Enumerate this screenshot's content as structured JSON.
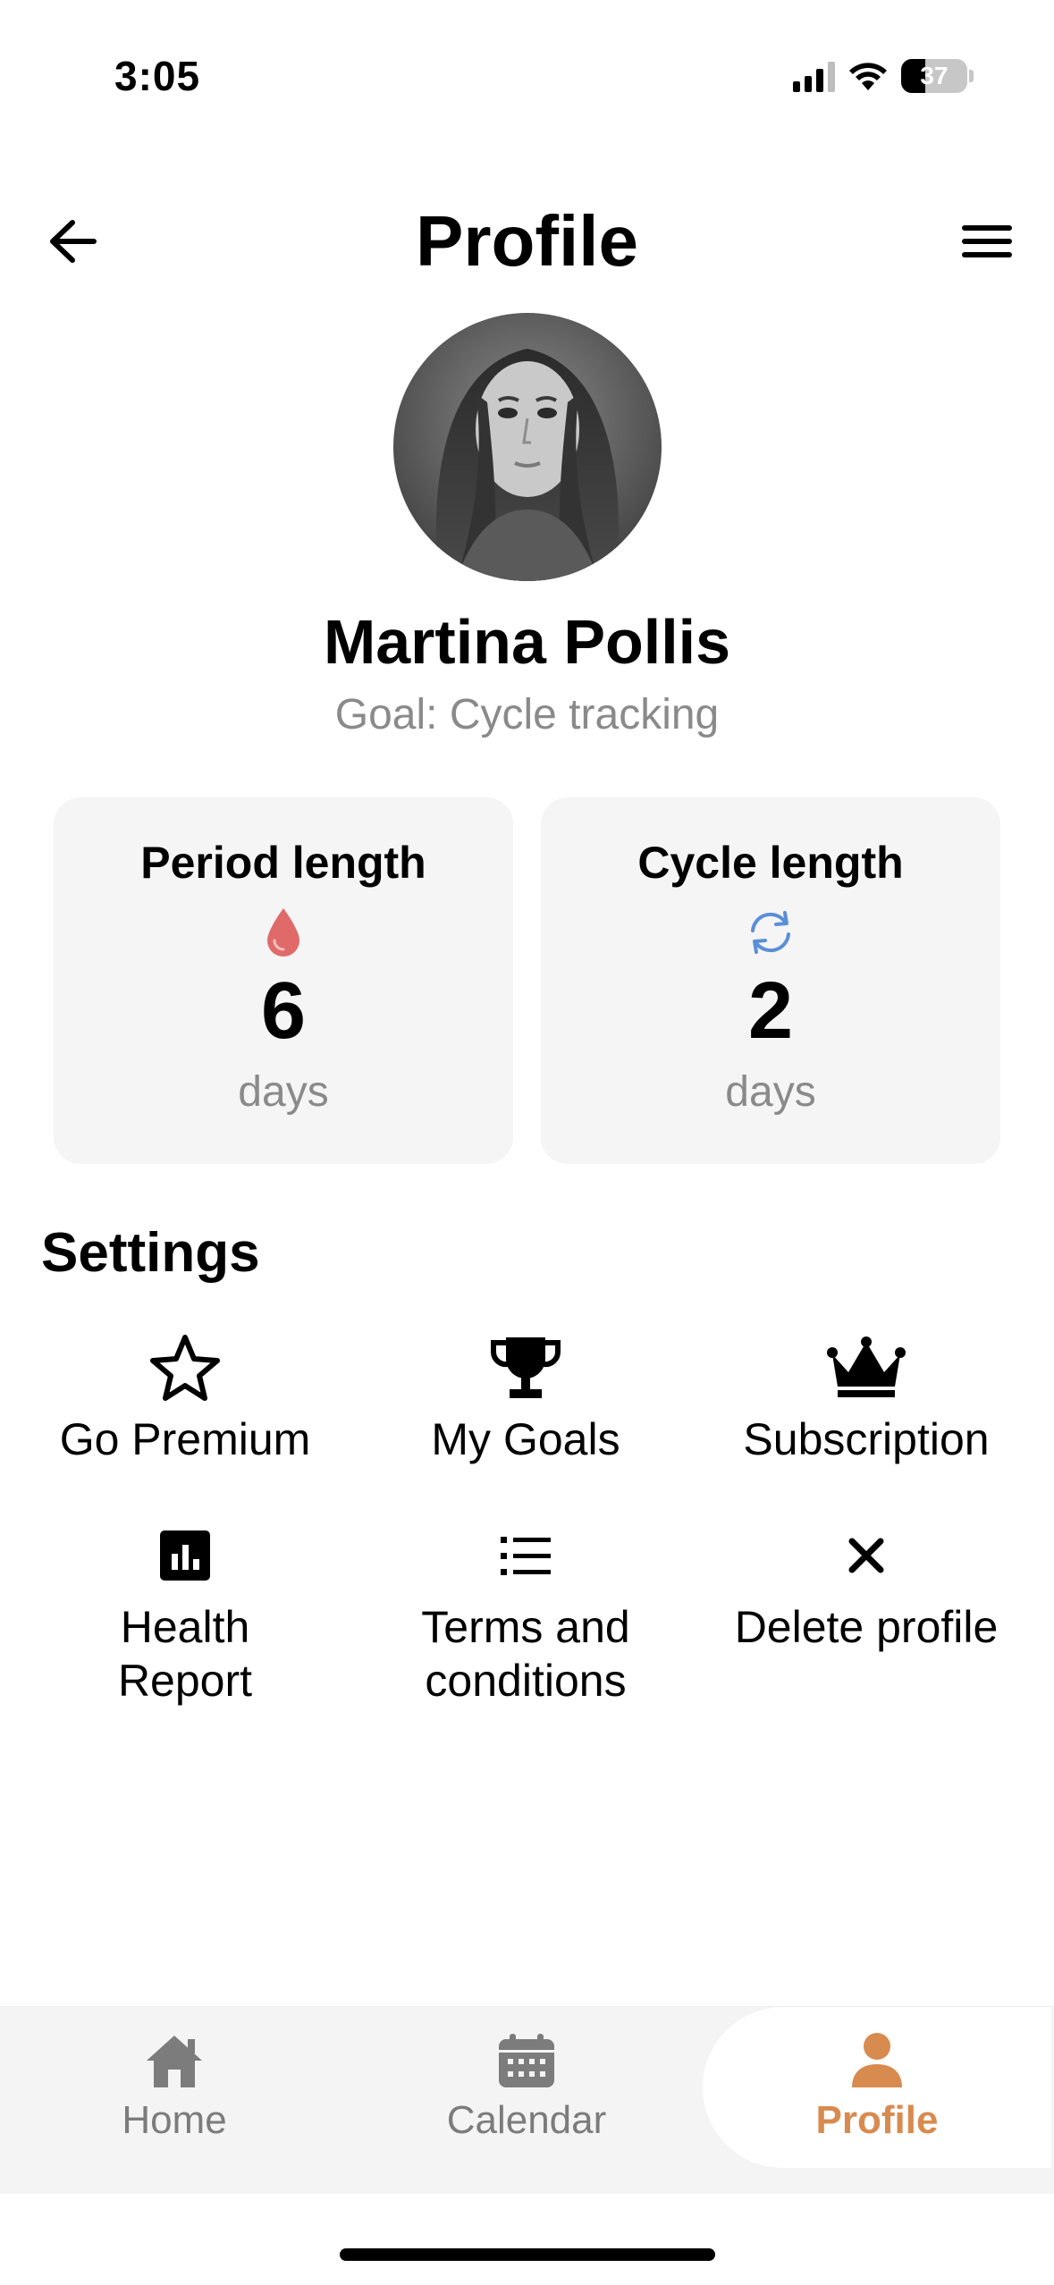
{
  "status_bar": {
    "time": "3:05",
    "battery": "37",
    "battery_level": 0.37
  },
  "header": {
    "title": "Profile",
    "back_icon": "arrow-left-icon",
    "menu_icon": "hamburger-menu-icon"
  },
  "profile": {
    "name": "Martina Pollis",
    "goal": "Goal: Cycle tracking"
  },
  "stats": {
    "period": {
      "title": "Period length",
      "icon": "blood-drop-icon",
      "value": "6",
      "unit": "days",
      "color": "#e06a6a"
    },
    "cycle": {
      "title": "Cycle length",
      "icon": "sync-icon",
      "value": "2",
      "unit": "days",
      "color": "#5b8fd6"
    }
  },
  "settings": {
    "heading": "Settings",
    "items": [
      {
        "label": "Go Premium",
        "icon": "star-icon"
      },
      {
        "label": "My Goals",
        "icon": "trophy-icon"
      },
      {
        "label": "Subscription",
        "icon": "crown-icon"
      },
      {
        "label": "Health Report",
        "icon": "chart-icon"
      },
      {
        "label": "Terms and conditions",
        "icon": "list-icon"
      },
      {
        "label": "Delete profile",
        "icon": "close-icon"
      }
    ]
  },
  "tabs": [
    {
      "label": "Home",
      "icon": "home-icon",
      "active": false
    },
    {
      "label": "Calendar",
      "icon": "calendar-icon",
      "active": false
    },
    {
      "label": "Profile",
      "icon": "person-icon",
      "active": true
    }
  ],
  "colors": {
    "accent": "#d88b4f",
    "inactive": "#7c7c7c",
    "card_bg": "#f5f5f5"
  }
}
